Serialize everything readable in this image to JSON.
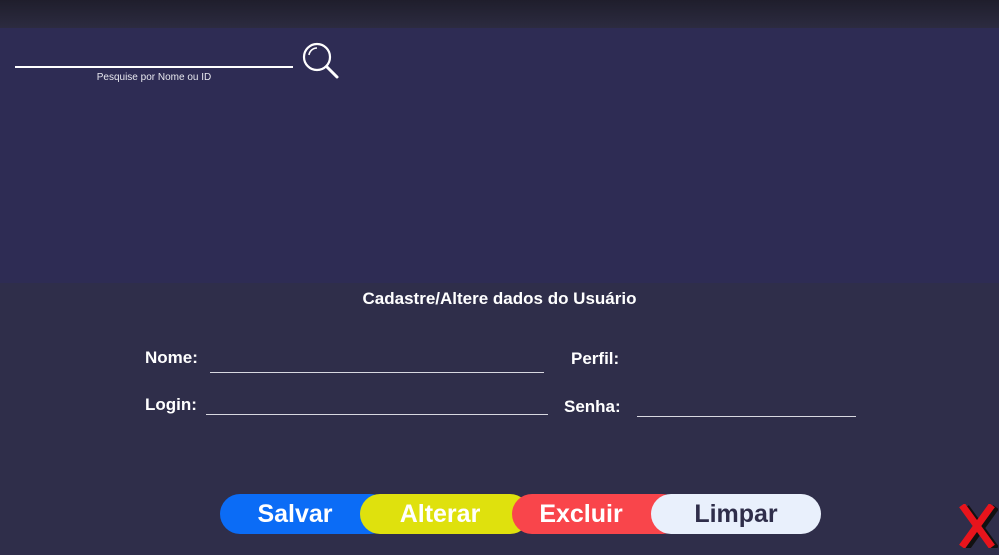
{
  "search": {
    "value": "",
    "hint": "Pesquise por Nome ou ID"
  },
  "form": {
    "title": "Cadastre/Altere dados do Usuário",
    "nome_label": "Nome:",
    "nome_value": "",
    "perfil_label": "Perfil:",
    "login_label": "Login:",
    "login_value": "",
    "senha_label": "Senha:",
    "senha_value": ""
  },
  "buttons": {
    "salvar": "Salvar",
    "alterar": "Alterar",
    "excluir": "Excluir",
    "limpar": "Limpar"
  },
  "icons": {
    "search": "search-icon",
    "close": "close-icon"
  },
  "colors": {
    "salvar": "#0b6cf6",
    "alterar": "#dfe10d",
    "excluir": "#f9454b",
    "limpar": "#e9f0fc",
    "close": "#e8141c"
  }
}
